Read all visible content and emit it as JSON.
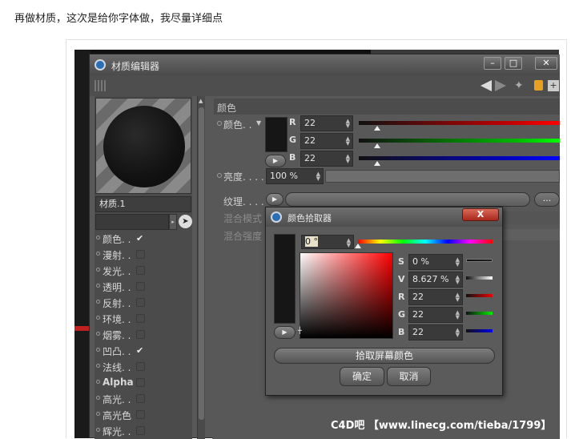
{
  "caption": "再做材质，这次是给你字体做，我尽量详细点",
  "material_editor": {
    "title": "材质编辑器",
    "material_name": "材质.1",
    "channels": [
      {
        "label": "颜色. .",
        "checked": true
      },
      {
        "label": "漫射. .",
        "checked": false
      },
      {
        "label": "发光. .",
        "checked": false
      },
      {
        "label": "透明. .",
        "checked": false
      },
      {
        "label": "反射. .",
        "checked": false
      },
      {
        "label": "环境. .",
        "checked": false
      },
      {
        "label": "烟雾. .",
        "checked": false
      },
      {
        "label": "凹凸. .",
        "checked": true
      },
      {
        "label": "法线. .",
        "checked": false
      },
      {
        "label": "Alpha",
        "checked": false
      },
      {
        "label": "高光. .",
        "checked": false
      },
      {
        "label": "高光色",
        "checked": false
      },
      {
        "label": "辉光. .",
        "checked": false
      }
    ],
    "section_title": "颜色",
    "color_label": "颜色. .",
    "r_label": "R",
    "r_value": "22",
    "g_label": "G",
    "g_value": "22",
    "b_label": "B",
    "b_value": "22",
    "brightness_label": "亮度. . . .",
    "brightness_value": "100 %",
    "texture_label": "纹理. . . .",
    "texture_more": "...",
    "blend_mode_label": "混合模式",
    "blend_strength_label": "混合强度",
    "base_color": "#161616"
  },
  "color_picker": {
    "title": "颜色拾取器",
    "hue_value": "0 °",
    "s_label": "S",
    "s_value": "0 %",
    "v_label": "V",
    "v_value": "8.627 %",
    "r_label": "R",
    "r_value": "22",
    "g_label": "G",
    "g_value": "22",
    "b_label": "B",
    "b_value": "22",
    "pick_screen_label": "拾取屏幕颜色",
    "ok_label": "确定",
    "cancel_label": "取消",
    "close_label": "X"
  },
  "watermark": "C4D吧 【www.linecg.com/tieba/1799】"
}
